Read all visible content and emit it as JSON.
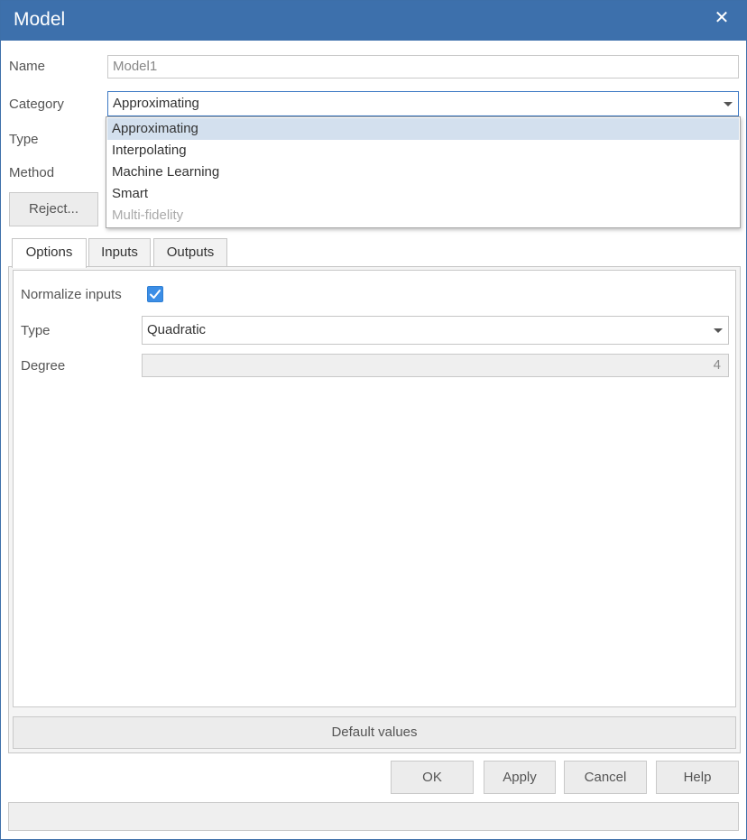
{
  "window": {
    "title": "Model"
  },
  "icons": {
    "close": "close-icon",
    "checkmark": "checkmark-icon",
    "chevron": "chevron-down-icon"
  },
  "form": {
    "name_label": "Name",
    "name_value": "Model1",
    "category_label": "Category",
    "category_value": "Approximating",
    "type_label": "Type",
    "method_label": "Method",
    "reject_label": "Reject..."
  },
  "category_options": [
    {
      "label": "Approximating",
      "selected": true,
      "disabled": false
    },
    {
      "label": "Interpolating",
      "selected": false,
      "disabled": false
    },
    {
      "label": "Machine Learning",
      "selected": false,
      "disabled": false
    },
    {
      "label": "Smart",
      "selected": false,
      "disabled": false
    },
    {
      "label": "Multi-fidelity",
      "selected": false,
      "disabled": true
    }
  ],
  "tabs": [
    {
      "label": "Options",
      "active": true
    },
    {
      "label": "Inputs",
      "active": false
    },
    {
      "label": "Outputs",
      "active": false
    }
  ],
  "options": {
    "normalize_label": "Normalize inputs",
    "normalize_checked": true,
    "type_label": "Type",
    "type_value": "Quadratic",
    "degree_label": "Degree",
    "degree_value": "4",
    "default_values_label": "Default values"
  },
  "buttons": {
    "ok": "OK",
    "apply": "Apply",
    "cancel": "Cancel",
    "help": "Help"
  },
  "colors": {
    "title_bar": "#3d70ac",
    "selected_item": "#d3e0ee",
    "checkbox": "#3c8ee6"
  }
}
